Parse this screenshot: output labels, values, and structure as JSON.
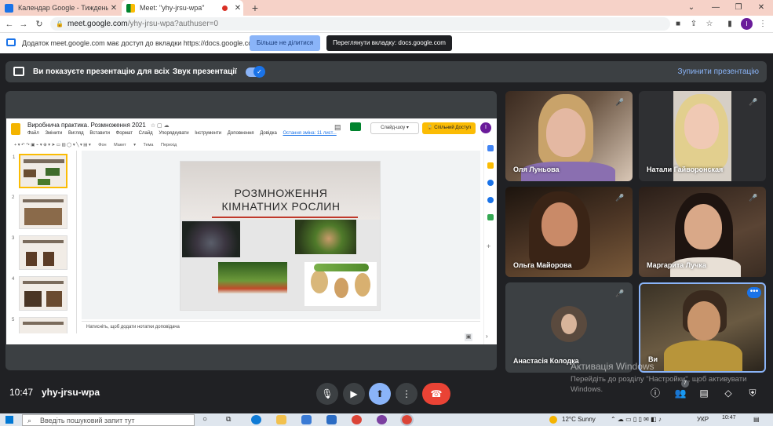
{
  "browser": {
    "tabs": [
      {
        "title": "Календар Google - Тиждень (1 ...",
        "close": "✕"
      },
      {
        "title": "Meet: \"yhy-jrsu-wpa\"",
        "close": "✕"
      }
    ],
    "new_tab": "+",
    "url_host": "meet.google.com",
    "url_path": "/yhy-jrsu-wpa?authuser=0",
    "profile_initial": "I"
  },
  "infobar": {
    "message": "Додаток meet.google.com має доступ до вкладки https://docs.google.com",
    "stop_sharing": "Більше не ділитися",
    "view_tab": "Переглянути вкладку: docs.google.com"
  },
  "present_bar": {
    "presenting_text": "Ви показуєте презентацію для всіх",
    "sound_label": "Звук презентації",
    "sound_on": true,
    "stop_label": "Зупинити презентацію"
  },
  "slides_doc": {
    "title": "Виробнича практика. Розмноження 2021",
    "menu": [
      "Файл",
      "Змінити",
      "Вигляд",
      "Вставити",
      "Формат",
      "Слайд",
      "Упорядкувати",
      "Інструменти",
      "Доповнення",
      "Довідка"
    ],
    "last_edit": "Остання зміна: 11 лист...",
    "slideshow": "Слайд-шоу",
    "share": "Спільний Доступ",
    "avatar": "I",
    "toolbar": [
      "Фон",
      "Макет",
      "Тема",
      "Перехід"
    ],
    "slide_title_line1": "РОЗМНОЖЕННЯ",
    "slide_title_line2": "КІМНАТНИХ РОСЛИН",
    "thumb_numbers": [
      "1",
      "2",
      "3",
      "4",
      "5"
    ],
    "notes_placeholder": "Натисніть, щоб додати нотатки доповідача"
  },
  "participants": [
    {
      "name": "Оля Луньова"
    },
    {
      "name": "Натали Гайворонская"
    },
    {
      "name": "Ольга Майорова"
    },
    {
      "name": "Маргарита Лучка"
    },
    {
      "name": "Анастасія Колодка"
    },
    {
      "name": "Ви"
    }
  ],
  "meeting": {
    "time": "10:47",
    "code": "yhy-jrsu-wpa",
    "people_count": "7"
  },
  "watermark": {
    "line1": "Активація Windows",
    "line2": "Перейдіть до розділу \"Настройки\", щоб активувати Windows."
  },
  "taskbar": {
    "search_placeholder": "Введіть пошуковий запит тут",
    "weather": "12°C  Sunny",
    "lang": "УКР",
    "clock": "10:47"
  },
  "colors": {
    "meet_bg": "#202124",
    "accent_blue": "#8ab4f8",
    "end_call_red": "#ea4335",
    "slides_yellow": "#fbbc04"
  }
}
